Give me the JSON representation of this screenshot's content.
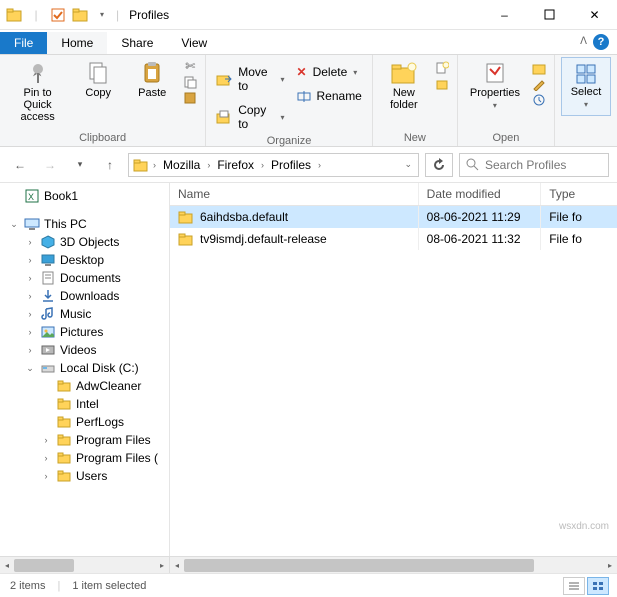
{
  "title": "Profiles",
  "window_controls": {
    "min": "–",
    "max": "▢",
    "close": "✕"
  },
  "tabs": {
    "file": "File",
    "home": "Home",
    "share": "Share",
    "view": "View"
  },
  "ribbon": {
    "clipboard": {
      "pin": "Pin to Quick\naccess",
      "copy": "Copy",
      "paste": "Paste",
      "cut": "Cut",
      "copy_path": "Copy path",
      "paste_shortcut": "Paste shortcut",
      "group": "Clipboard"
    },
    "organize": {
      "move_to": "Move to",
      "copy_to": "Copy to",
      "delete": "Delete",
      "rename": "Rename",
      "group": "Organize"
    },
    "new": {
      "new_folder": "New\nfolder",
      "new_item": "New item",
      "easy_access": "Easy access",
      "group": "New"
    },
    "open": {
      "properties": "Properties",
      "open": "Open",
      "edit": "Edit",
      "history": "History",
      "group": "Open"
    },
    "select": {
      "select": "Select",
      "group": ""
    }
  },
  "breadcrumb": [
    "Mozilla",
    "Firefox",
    "Profiles"
  ],
  "search_placeholder": "Search Profiles",
  "columns": {
    "name": "Name",
    "date": "Date modified",
    "type": "Type"
  },
  "files": [
    {
      "name": "6aihdsba.default",
      "date": "08-06-2021 11:29",
      "type": "File fo",
      "selected": true
    },
    {
      "name": "tv9ismdj.default-release",
      "date": "08-06-2021 11:32",
      "type": "File fo",
      "selected": false
    }
  ],
  "tree": {
    "book1": "Book1",
    "this_pc": "This PC",
    "items_pc": [
      "3D Objects",
      "Desktop",
      "Documents",
      "Downloads",
      "Music",
      "Pictures",
      "Videos"
    ],
    "local_disk": "Local Disk (C:)",
    "folders_c": [
      "AdwCleaner",
      "Intel",
      "PerfLogs",
      "Program Files",
      "Program Files (",
      "Users"
    ]
  },
  "status": {
    "count": "2 items",
    "sel": "1 item selected"
  },
  "watermark": "wsxdn.com"
}
